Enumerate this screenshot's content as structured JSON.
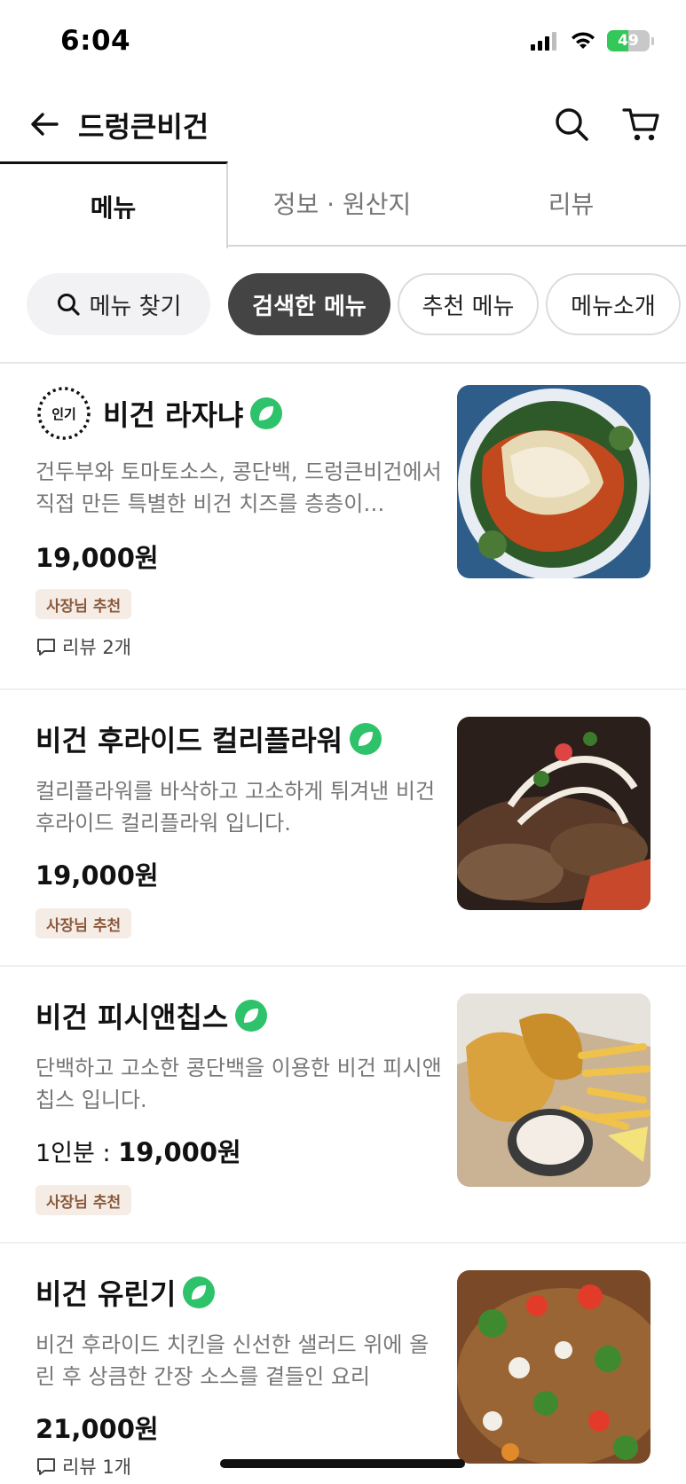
{
  "status_bar": {
    "time": "6:04",
    "battery": "49",
    "battery_level_pct": 49
  },
  "header": {
    "title": "드렁큰비건"
  },
  "tabs": [
    {
      "label": "메뉴",
      "active": true
    },
    {
      "label": "정보 · 원산지",
      "active": false
    },
    {
      "label": "리뷰",
      "active": false
    }
  ],
  "chips": {
    "search": "메뉴 찾기",
    "items": [
      "검색한 메뉴",
      "추천 메뉴",
      "메뉴소개"
    ],
    "selected": "검색한 메뉴"
  },
  "menu_items": [
    {
      "popular_label": "인기",
      "title": "비건 라자냐",
      "desc": "건두부와 토마토소스, 콩단백, 드렁큰비건에서 직접 만든 특별한 비건 치즈를 층층이…",
      "price": "19,000원",
      "badge": "사장님 추천",
      "reviews": "리뷰 2개"
    },
    {
      "title": "비건 후라이드 컬리플라워",
      "desc": "컬리플라워를 바삭하고 고소하게 튀겨낸 비건 후라이드 컬리플라워 입니다.",
      "price": "19,000원",
      "badge": "사장님 추천"
    },
    {
      "title": "비건 피시앤칩스",
      "desc": "단백하고 고소한 콩단백을 이용한 비건 피시앤칩스 입니다.",
      "price_prefix": "1인분 : ",
      "price": "19,000원",
      "badge": "사장님 추천"
    },
    {
      "title": "비건 유린기",
      "desc": "비건 후라이드 치킨을 신선한 샐러드 위에 올린 후 상큼한 간장 소스를 곁들인 요리",
      "price": "21,000원",
      "reviews": "리뷰 1개"
    }
  ],
  "colors": {
    "vegan_green": "#2ec26a",
    "selected_chip": "#444444",
    "owner_badge_bg": "#f6ece6",
    "owner_badge_text": "#8a5a3c"
  },
  "icons": [
    "back-arrow-icon",
    "search-icon",
    "cart-icon",
    "leaf-icon",
    "comment-icon"
  ]
}
